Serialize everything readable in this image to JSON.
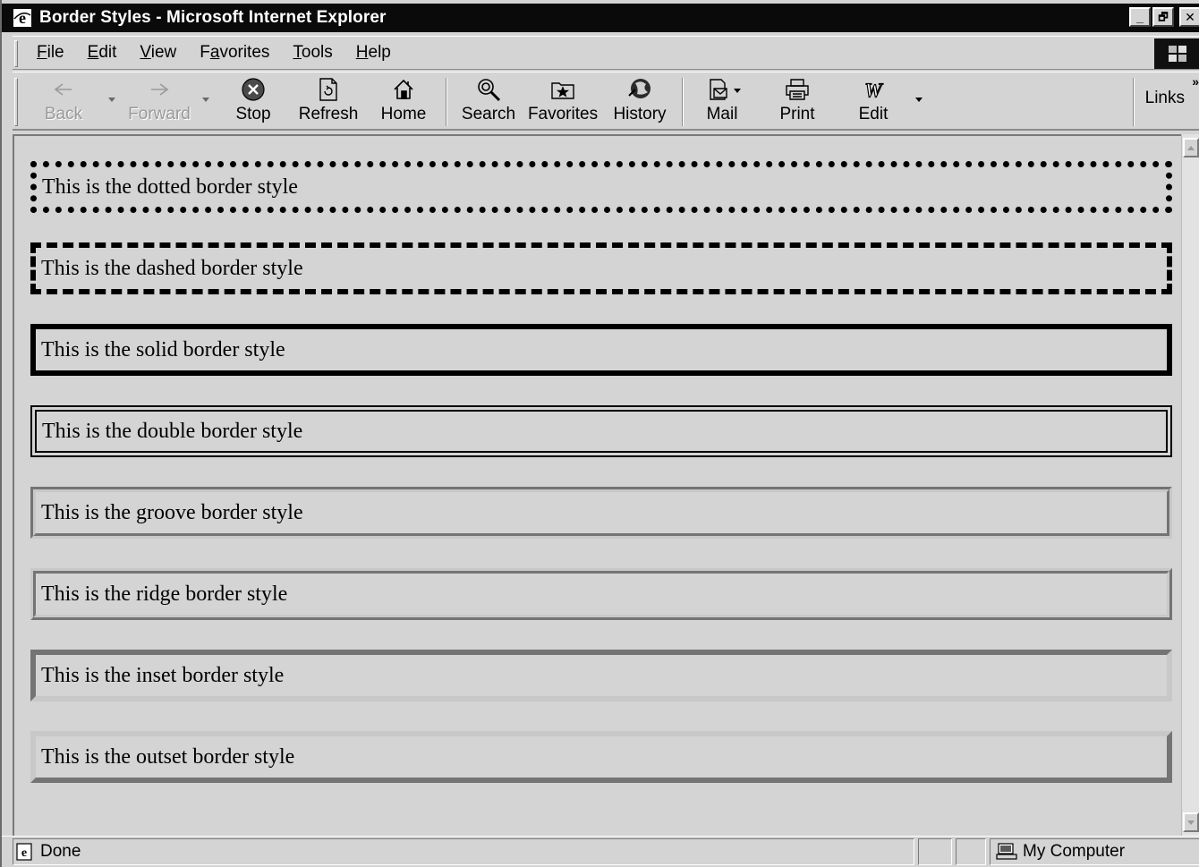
{
  "window": {
    "title": "Border Styles - Microsoft Internet Explorer",
    "controls": [
      "_",
      "🗗",
      "✕"
    ]
  },
  "menu": {
    "items": [
      {
        "ul": "F",
        "rest": "ile"
      },
      {
        "ul": "E",
        "rest": "dit"
      },
      {
        "ul": "V",
        "rest": "iew"
      },
      {
        "pre": "F",
        "ul": "a",
        "rest": "vorites"
      },
      {
        "ul": "T",
        "rest": "ools"
      },
      {
        "ul": "H",
        "rest": "elp"
      }
    ]
  },
  "toolbar": {
    "back": "Back",
    "forward": "Forward",
    "stop": "Stop",
    "refresh": "Refresh",
    "home": "Home",
    "search": "Search",
    "favorites": "Favorites",
    "history": "History",
    "mail": "Mail",
    "print": "Print",
    "edit": "Edit",
    "links": "Links",
    "links_chevron": "»"
  },
  "boxes": {
    "dotted": "This is the dotted border style",
    "dashed": "This is the dashed border style",
    "solid": "This is the solid border style",
    "double": "This is the double border style",
    "groove": "This is the groove border style",
    "ridge": "This is the ridge border style",
    "inset": "This is the inset border style",
    "outset": "This is the outset border style"
  },
  "status": {
    "text": "Done",
    "zone": "My Computer"
  },
  "colors": {
    "chrome": "#d4d4d4",
    "title_bar": "#0a0a0a",
    "border_dark": "#000000"
  }
}
